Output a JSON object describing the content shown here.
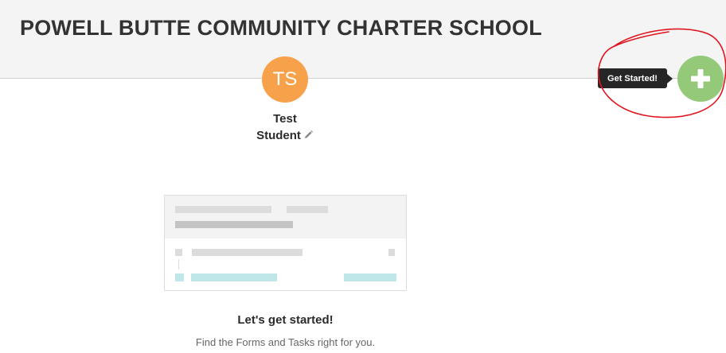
{
  "header": {
    "school_name": "POWELL BUTTE COMMUNITY CHARTER SCHOOL"
  },
  "profile": {
    "avatar_initials": "TS",
    "first_name": "Test",
    "last_name": "Student",
    "avatar_color": "#f7a24b"
  },
  "empty_state": {
    "heading": "Let's get started!",
    "subtext": "Find the Forms and Tasks right for you."
  },
  "action": {
    "tooltip": "Get Started!",
    "button_icon": "plus-icon",
    "button_color": "#95c97a"
  },
  "annotation_color": "#e0141e"
}
